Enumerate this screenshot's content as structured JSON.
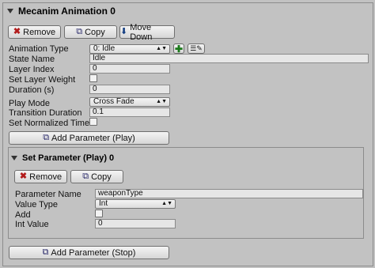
{
  "panel": {
    "title": "Mecanim Animation 0",
    "buttons": {
      "remove": "Remove",
      "copy": "Copy",
      "move_down": "Move Down"
    },
    "fields": {
      "animation_type": {
        "label": "Animation Type",
        "value": "0: Idle"
      },
      "state_name": {
        "label": "State Name",
        "value": "Idle"
      },
      "layer_index": {
        "label": "Layer Index",
        "value": "0"
      },
      "set_layer_weight": {
        "label": "Set Layer Weight",
        "checked": false
      },
      "duration": {
        "label": "Duration (s)",
        "value": "0"
      },
      "play_mode": {
        "label": "Play Mode",
        "value": "Cross Fade"
      },
      "transition_duration": {
        "label": "Transition Duration",
        "value": "0.1"
      },
      "set_normalized_time": {
        "label": "Set Normalized Time",
        "checked": false
      }
    },
    "add_parameter_play": "Add Parameter (Play)",
    "add_parameter_stop": "Add Parameter (Stop)"
  },
  "subpanel": {
    "title": "Set Parameter (Play) 0",
    "buttons": {
      "remove": "Remove",
      "copy": "Copy"
    },
    "fields": {
      "parameter_name": {
        "label": "Parameter Name",
        "value": "weaponType"
      },
      "value_type": {
        "label": "Value Type",
        "value": "Int"
      },
      "add": {
        "label": "Add",
        "checked": false
      },
      "int_value": {
        "label": "Int Value",
        "value": "0"
      }
    }
  },
  "icons": {
    "remove": "red-x-icon",
    "copy": "copy-icon",
    "move_down": "down-arrow-icon",
    "add_param": "add-parameter-icon",
    "add": "plus-icon",
    "edit": "list-edit-icon"
  }
}
